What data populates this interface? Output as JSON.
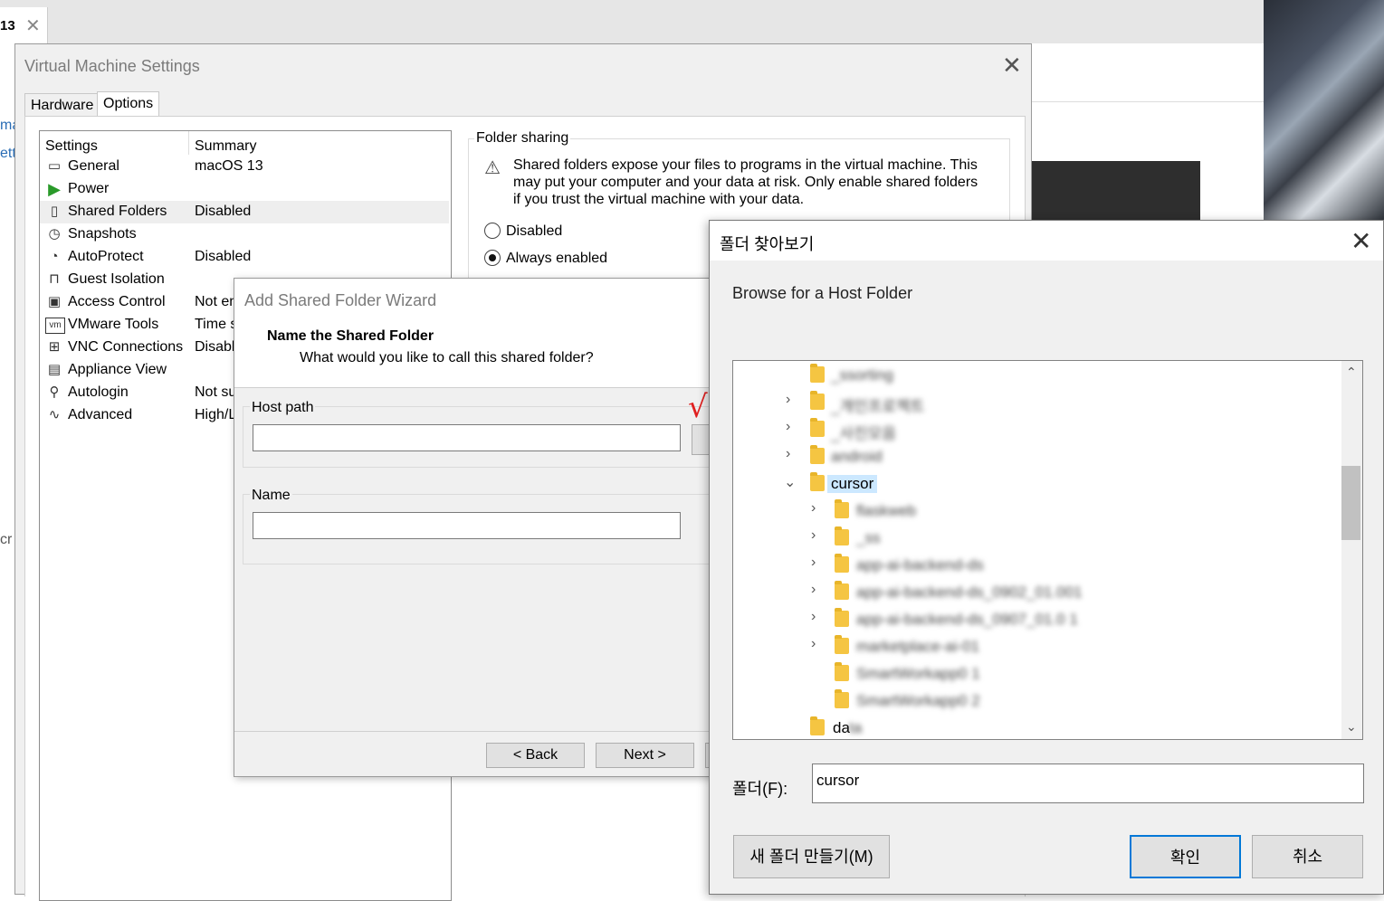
{
  "background": {
    "tab_label": "13",
    "fragments": [
      "ma",
      "ett",
      "cr"
    ]
  },
  "vm_settings": {
    "title": "Virtual Machine Settings",
    "tabs": [
      "Hardware",
      "Options"
    ],
    "columns": {
      "settings": "Settings",
      "summary": "Summary"
    },
    "rows": [
      {
        "name": "General",
        "summary": "macOS 13",
        "icon": "general-icon"
      },
      {
        "name": "Power",
        "summary": "",
        "icon": "power-icon"
      },
      {
        "name": "Shared Folders",
        "summary": "Disabled",
        "icon": "shared-folders-icon"
      },
      {
        "name": "Snapshots",
        "summary": "",
        "icon": "snapshots-icon"
      },
      {
        "name": "AutoProtect",
        "summary": "Disabled",
        "icon": "autoprotect-icon"
      },
      {
        "name": "Guest Isolation",
        "summary": "",
        "icon": "lock-icon"
      },
      {
        "name": "Access Control",
        "summary": "Not en",
        "icon": "access-control-icon"
      },
      {
        "name": "VMware Tools",
        "summary": "Time s",
        "icon": "vmware-tools-icon"
      },
      {
        "name": "VNC Connections",
        "summary": "Disabl",
        "icon": "vnc-icon"
      },
      {
        "name": "Appliance View",
        "summary": "",
        "icon": "appliance-view-icon"
      },
      {
        "name": "Autologin",
        "summary": "Not su",
        "icon": "autologin-icon"
      },
      {
        "name": "Advanced",
        "summary": "High/L",
        "icon": "advanced-icon"
      }
    ],
    "folder_sharing": {
      "legend": "Folder sharing",
      "warning": "Shared folders expose your files to programs in the virtual machine. This may put your computer and your data at risk. Only enable shared folders if you trust the virtual machine with your data.",
      "options": [
        {
          "label": "Disabled",
          "selected": false
        },
        {
          "label": "Always enabled",
          "selected": true
        }
      ]
    }
  },
  "wizard": {
    "title": "Add Shared Folder Wizard",
    "heading": "Name the Shared Folder",
    "subheading": "What would you like to call this shared folder?",
    "host_path_label": "Host path",
    "host_path_value": "",
    "name_label": "Name",
    "name_value": "",
    "back_button": "< Back",
    "next_button": "Next >"
  },
  "browse": {
    "title": "폴더 찾아보기",
    "description": "Browse for a Host Folder",
    "tree": [
      {
        "label": "_ssorting",
        "level": 1,
        "expander": "none",
        "blurred": true
      },
      {
        "label": "_개인프로젝트",
        "level": 1,
        "expander": "collapsed",
        "blurred": true
      },
      {
        "label": "_사진모음",
        "level": 1,
        "expander": "collapsed",
        "blurred": true
      },
      {
        "label": "android",
        "level": 1,
        "expander": "collapsed",
        "blurred": true
      },
      {
        "label": "cursor",
        "level": 1,
        "expander": "expanded",
        "blurred": false,
        "selected": true
      },
      {
        "label": "flaskweb",
        "level": 2,
        "expander": "collapsed",
        "blurred": true
      },
      {
        "label": "_ss",
        "level": 2,
        "expander": "collapsed",
        "blurred": true
      },
      {
        "label": "app-ai-backend-ds",
        "level": 2,
        "expander": "collapsed",
        "blurred": true
      },
      {
        "label": "app-ai-backend-ds_0902_01.001",
        "level": 2,
        "expander": "collapsed",
        "blurred": true
      },
      {
        "label": "app-ai-backend-ds_0907_01.0 1",
        "level": 2,
        "expander": "collapsed",
        "blurred": true
      },
      {
        "label": "marketplace-ai-01",
        "level": 2,
        "expander": "collapsed",
        "blurred": true
      },
      {
        "label": "SmartWorkapp0 1",
        "level": 2,
        "expander": "none",
        "blurred": true
      },
      {
        "label": "SmartWorkapp0 2",
        "level": 2,
        "expander": "none",
        "blurred": true
      },
      {
        "label": "da",
        "level": 1,
        "expander": "none",
        "blurred": false,
        "tail": "ta"
      }
    ],
    "folder_label": "폴더(F):",
    "folder_value": "cursor",
    "new_folder_button": "새 폴더 만들기(M)",
    "ok_button": "확인",
    "cancel_button": "취소"
  },
  "annotation": {
    "checkmark": "√"
  }
}
